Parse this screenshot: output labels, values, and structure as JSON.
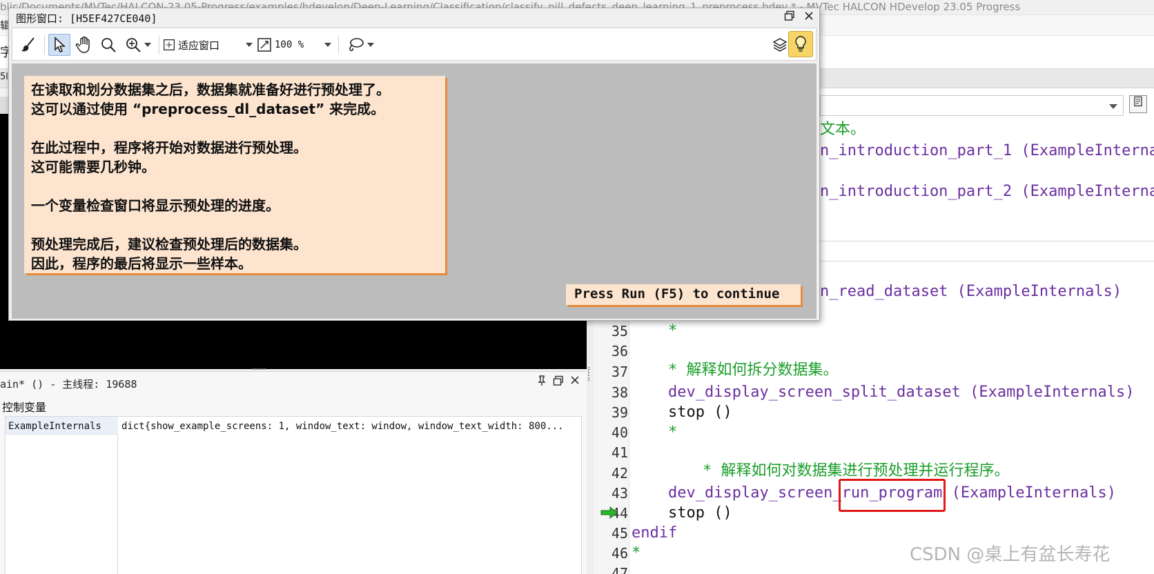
{
  "background_window": {
    "title": "blic/Documents/MVTec/HALCON-23.05-Progress/examples/hdevelop/Deep-Learning/Classification/classify_pill_defects_deep_learning_1_preprocess.hdev * - MVTec HALCON HDevelop 23.05 Progress",
    "left_fragments": [
      "辑",
      "字",
      "E",
      "5l"
    ]
  },
  "graphics_window": {
    "title": "图形窗口: [H5EF427CE040]",
    "toolbar": {
      "fit_window_label": "适应窗口",
      "zoom_value": "100 %"
    },
    "message_lines": [
      "在读取和划分数据集之后，数据集就准备好进行预处理了。",
      "这可以通过使用 “preprocess_dl_dataset” 来完成。",
      "",
      "在此过程中，程序将开始对数据进行预处理。",
      "这可能需要几秒钟。",
      "",
      "一个变量检查窗口将显示预处理的进度。",
      "",
      "预处理完成后，建议检查预处理后的数据集。",
      "因此，程序的最后将显示一些样本。"
    ],
    "continue_text": "Press Run (F5) to continue"
  },
  "variable_panel": {
    "title": "ain* () - 主线程: 19688",
    "section_label": "控制变量",
    "variable_name": "ExampleInternals",
    "variable_value": "dict{show_example_screens: 1, window_text: window, window_text_width: 800..."
  },
  "editor": {
    "partial_lines": [
      {
        "text": "文本。",
        "color": "green"
      },
      {
        "text": "n_introduction_part_1 (ExampleInterna",
        "color": "purple"
      },
      {
        "text": "n_introduction_part_2 (ExampleInterna",
        "color": "purple"
      },
      {
        "text": "n_read_dataset (ExampleInternals)",
        "color": "purple"
      }
    ],
    "lines": [
      {
        "num": "35",
        "text": "*",
        "color": "green",
        "indent": 1
      },
      {
        "num": "36",
        "text": "",
        "color": "black",
        "indent": 1
      },
      {
        "num": "37",
        "text": "* 解释如何拆分数据集。",
        "color": "green",
        "indent": 1
      },
      {
        "num": "38",
        "text": "dev_display_screen_split_dataset (ExampleInternals)",
        "color": "purple",
        "indent": 1
      },
      {
        "num": "39",
        "text": "stop ()",
        "color": "black",
        "indent": 1
      },
      {
        "num": "40",
        "text": "*",
        "color": "green",
        "indent": 1
      },
      {
        "num": "41",
        "text": "",
        "color": "black",
        "indent": 1
      },
      {
        "num": "42",
        "text": "* 解释如何对数据集进行预处理并运行程序。",
        "color": "green",
        "indent": 2
      },
      {
        "num": "43",
        "text": "dev_display_screen_run_program (ExampleInternals)",
        "color": "purple",
        "indent": 1
      },
      {
        "num": "44",
        "text": "stop ()",
        "color": "black",
        "indent": 1
      },
      {
        "num": "45",
        "text": "endif",
        "color": "purple",
        "indent": 0
      },
      {
        "num": "46",
        "text": "*",
        "color": "green",
        "indent": 0
      },
      {
        "num": "47",
        "text": "",
        "color": "black",
        "indent": 0
      }
    ],
    "highlighted_token": "run_program"
  },
  "watermark": "CSDN @桌上有盆长寿花",
  "colors": {
    "keyword_purple": "#6b2fa0",
    "comment_green": "#1a9e2a",
    "message_bg": "#fce4cf",
    "message_shadow": "#e78a3a",
    "highlight_red": "#e01818",
    "canvas_gray": "#bcbcbc"
  },
  "icons": [
    "brush-icon",
    "pointer-icon",
    "hand-icon",
    "search-icon",
    "zoom-in-icon",
    "fit-window-icon",
    "zoom-percent-icon",
    "lasso-icon",
    "layers-icon",
    "lightbulb-icon",
    "restore-icon",
    "close-icon",
    "pin-icon",
    "current-line-arrow-icon"
  ]
}
